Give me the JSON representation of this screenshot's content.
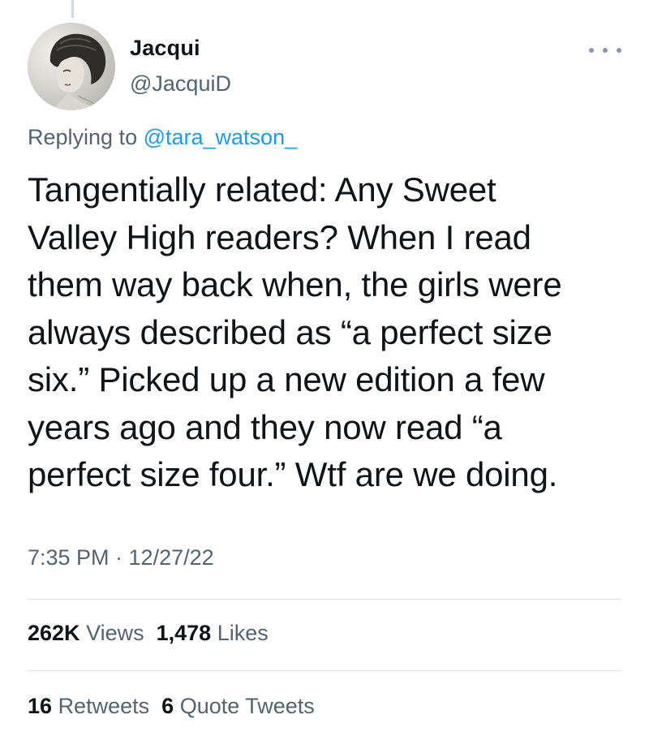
{
  "tweet": {
    "author": {
      "display_name": "Jacqui",
      "handle": "@JacquiD"
    },
    "more_icon": "ellipsis-horizontal-icon",
    "replying_prefix": "Replying to ",
    "replying_to": "@tara_watson_",
    "text": "Tangentially related: Any Sweet\nValley High readers? When I read\nthem way back when, the girls were\nalways described as “a perfect size\nsix.” Picked up a new edition a few\nyears ago and they now read “a\nperfect size four.” Wtf are we doing.",
    "timestamp": "7:35 PM · 12/27/22",
    "stats": {
      "views_count": "262K",
      "views_label": "Views",
      "likes_count": "1,478",
      "likes_label": "Likes",
      "retweets_count": "16",
      "retweets_label": "Retweets",
      "quotes_count": "6",
      "quotes_label": "Quote Tweets"
    }
  },
  "colors": {
    "text": "#0f1419",
    "secondary": "#536471",
    "link": "#1d9bf0",
    "divider": "#dfe3e6"
  }
}
